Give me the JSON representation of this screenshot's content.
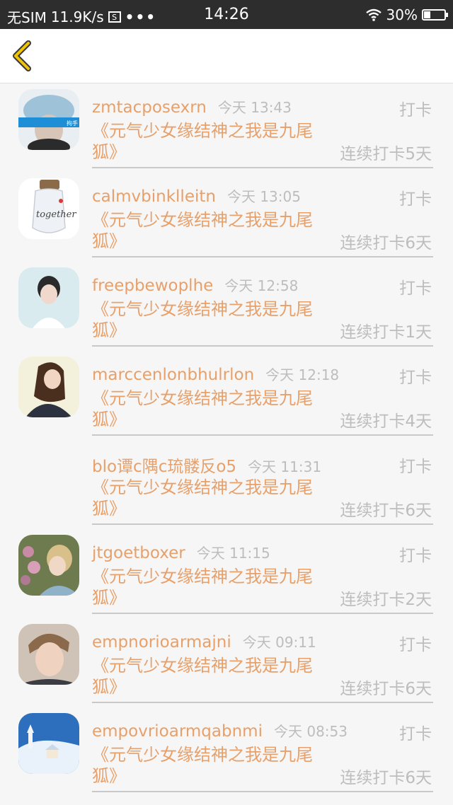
{
  "status_bar": {
    "carrier": "无SIM",
    "speed": "11.9K/s",
    "sim_icon_label": "S",
    "dots": "•••",
    "time": "14:26",
    "battery": "30%",
    "icons": [
      "sim-icon",
      "more-dots-icon",
      "wifi-icon",
      "battery-icon"
    ]
  },
  "header": {
    "back_icon": "chevron-left-icon",
    "accent": "#f0c400"
  },
  "colors": {
    "name": "#e8a06a",
    "muted": "#bdbdbd",
    "divider": "#c9c9c9"
  },
  "checkins": [
    {
      "user": "zmtacposexrn",
      "time": "今天 13:43",
      "action": "打卡",
      "title": "《元气少女缘结神之我是九尾狐》",
      "streak": "连续打卡5天",
      "avatar": "cap-girl-avatar"
    },
    {
      "user": "calmvbinklleitn",
      "time": "今天 13:05",
      "action": "打卡",
      "title": "《元气少女缘结神之我是九尾狐》",
      "streak": "连续打卡6天",
      "avatar": "together-jar-avatar"
    },
    {
      "user": "freepbewoplhe",
      "time": "今天 12:58",
      "action": "打卡",
      "title": "《元气少女缘结神之我是九尾狐》",
      "streak": "连续打卡1天",
      "avatar": "girl-portrait-avatar"
    },
    {
      "user": "marccenlonbhulrlon",
      "time": "今天 12:18",
      "action": "打卡",
      "title": "《元气少女缘结神之我是九尾狐》",
      "streak": "连续打卡4天",
      "avatar": "girl-longhair-avatar"
    },
    {
      "user": "blo谭c隅c琉髅反o5",
      "time": "今天 11:31",
      "action": "打卡",
      "title": "《元气少女缘结神之我是九尾狐》",
      "streak": "连续打卡6天",
      "avatar": "empty-avatar"
    },
    {
      "user": "jtgoetboxer",
      "time": "今天 11:15",
      "action": "打卡",
      "title": "《元气少女缘结神之我是九尾狐》",
      "streak": "连续打卡2天",
      "avatar": "flowers-girl-avatar"
    },
    {
      "user": "empnorioarmajni",
      "time": "今天 09:11",
      "action": "打卡",
      "title": "《元气少女缘结神之我是九尾狐》",
      "streak": "连续打卡6天",
      "avatar": "boy-avatar"
    },
    {
      "user": "empovrioarmqabnmi",
      "time": "今天 08:53",
      "action": "打卡",
      "title": "《元气少女缘结神之我是九尾狐》",
      "streak": "连续打卡6天",
      "avatar": "snow-village-avatar"
    }
  ]
}
